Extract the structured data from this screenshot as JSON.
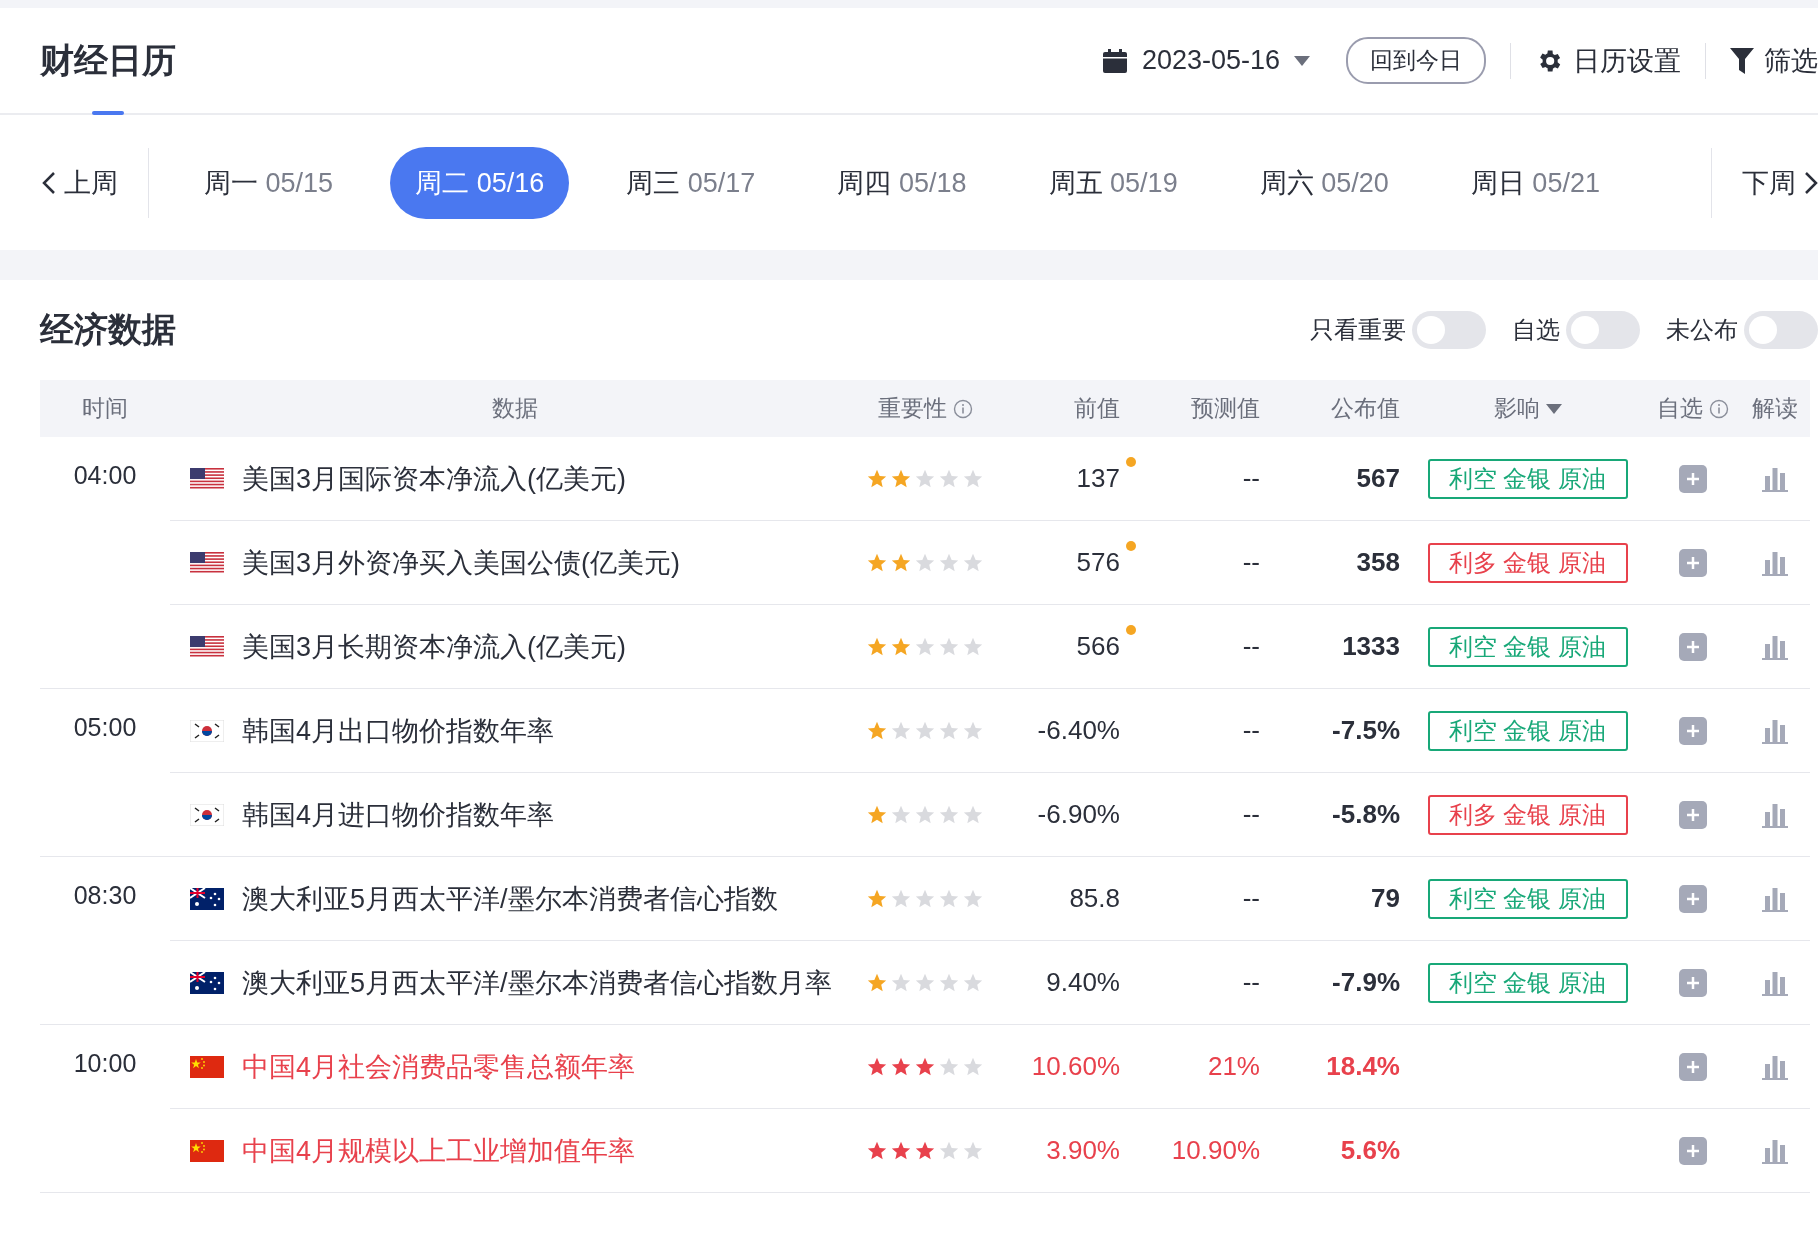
{
  "header": {
    "tabs": [
      {
        "label": "财经日历",
        "selected": true
      }
    ],
    "date": "2023-05-16",
    "today_button": "回到今日",
    "settings": "日历设置",
    "filter": "筛选"
  },
  "week": {
    "prev": "上周",
    "next": "下周",
    "days": [
      {
        "weekday": "周一",
        "date": "05/15",
        "selected": false
      },
      {
        "weekday": "周二",
        "date": "05/16",
        "selected": true
      },
      {
        "weekday": "周三",
        "date": "05/17",
        "selected": false
      },
      {
        "weekday": "周四",
        "date": "05/18",
        "selected": false
      },
      {
        "weekday": "周五",
        "date": "05/19",
        "selected": false
      },
      {
        "weekday": "周六",
        "date": "05/20",
        "selected": false
      },
      {
        "weekday": "周日",
        "date": "05/21",
        "selected": false
      }
    ]
  },
  "section": {
    "title": "经济数据",
    "toggles": [
      {
        "label": "只看重要",
        "on": false
      },
      {
        "label": "自选",
        "on": false
      },
      {
        "label": "未公布",
        "on": false
      }
    ]
  },
  "table": {
    "columns": [
      {
        "label": "时间",
        "kind": "plain"
      },
      {
        "label": "数据",
        "kind": "plain"
      },
      {
        "label": "重要性",
        "kind": "info"
      },
      {
        "label": "前值",
        "kind": "plain"
      },
      {
        "label": "预测值",
        "kind": "plain"
      },
      {
        "label": "公布值",
        "kind": "plain"
      },
      {
        "label": "影响",
        "kind": "sort"
      },
      {
        "label": "自选",
        "kind": "info"
      },
      {
        "label": "解读",
        "kind": "plain"
      }
    ],
    "groups": [
      {
        "time": "04:00",
        "rows": [
          {
            "flag": {
              "kind": "us"
            },
            "name": "美国3月国际资本净流入(亿美元)",
            "stars": 2,
            "important": false,
            "previous": "137",
            "revised": true,
            "forecast": "--",
            "actual": "567",
            "impact": {
              "kind": "bearish",
              "text": "利空 金银 原油"
            }
          },
          {
            "flag": {
              "kind": "us"
            },
            "name": "美国3月外资净买入美国公债(亿美元)",
            "stars": 2,
            "important": false,
            "previous": "576",
            "revised": true,
            "forecast": "--",
            "actual": "358",
            "impact": {
              "kind": "bullish",
              "text": "利多 金银 原油"
            }
          },
          {
            "flag": {
              "kind": "us"
            },
            "name": "美国3月长期资本净流入(亿美元)",
            "stars": 2,
            "important": false,
            "previous": "566",
            "revised": true,
            "forecast": "--",
            "actual": "1333",
            "impact": {
              "kind": "bearish",
              "text": "利空 金银 原油"
            }
          }
        ]
      },
      {
        "time": "05:00",
        "rows": [
          {
            "flag": {
              "kind": "kr"
            },
            "name": "韩国4月出口物价指数年率",
            "stars": 1,
            "important": false,
            "previous": "-6.40%",
            "revised": false,
            "forecast": "--",
            "actual": "-7.5%",
            "impact": {
              "kind": "bearish",
              "text": "利空 金银 原油"
            }
          },
          {
            "flag": {
              "kind": "kr"
            },
            "name": "韩国4月进口物价指数年率",
            "stars": 1,
            "important": false,
            "previous": "-6.90%",
            "revised": false,
            "forecast": "--",
            "actual": "-5.8%",
            "impact": {
              "kind": "bullish",
              "text": "利多 金银 原油"
            }
          }
        ]
      },
      {
        "time": "08:30",
        "rows": [
          {
            "flag": {
              "kind": "au"
            },
            "name": "澳大利亚5月西太平洋/墨尔本消费者信心指数",
            "stars": 1,
            "important": false,
            "previous": "85.8",
            "revised": false,
            "forecast": "--",
            "actual": "79",
            "impact": {
              "kind": "bearish",
              "text": "利空 金银 原油"
            }
          },
          {
            "flag": {
              "kind": "au"
            },
            "name": "澳大利亚5月西太平洋/墨尔本消费者信心指数月率",
            "stars": 1,
            "important": false,
            "previous": "9.40%",
            "revised": false,
            "forecast": "--",
            "actual": "-7.9%",
            "impact": {
              "kind": "bearish",
              "text": "利空 金银 原油"
            }
          }
        ]
      },
      {
        "time": "10:00",
        "rows": [
          {
            "flag": {
              "kind": "cn"
            },
            "name": "中国4月社会消费品零售总额年率",
            "stars": 3,
            "important": true,
            "previous": "10.60%",
            "revised": false,
            "forecast": "21%",
            "actual": "18.4%"
          },
          {
            "flag": {
              "kind": "cn"
            },
            "name": "中国4月规模以上工业增加值年率",
            "stars": 3,
            "important": true,
            "previous": "3.90%",
            "revised": false,
            "forecast": "10.90%",
            "actual": "5.6%"
          }
        ]
      }
    ]
  }
}
